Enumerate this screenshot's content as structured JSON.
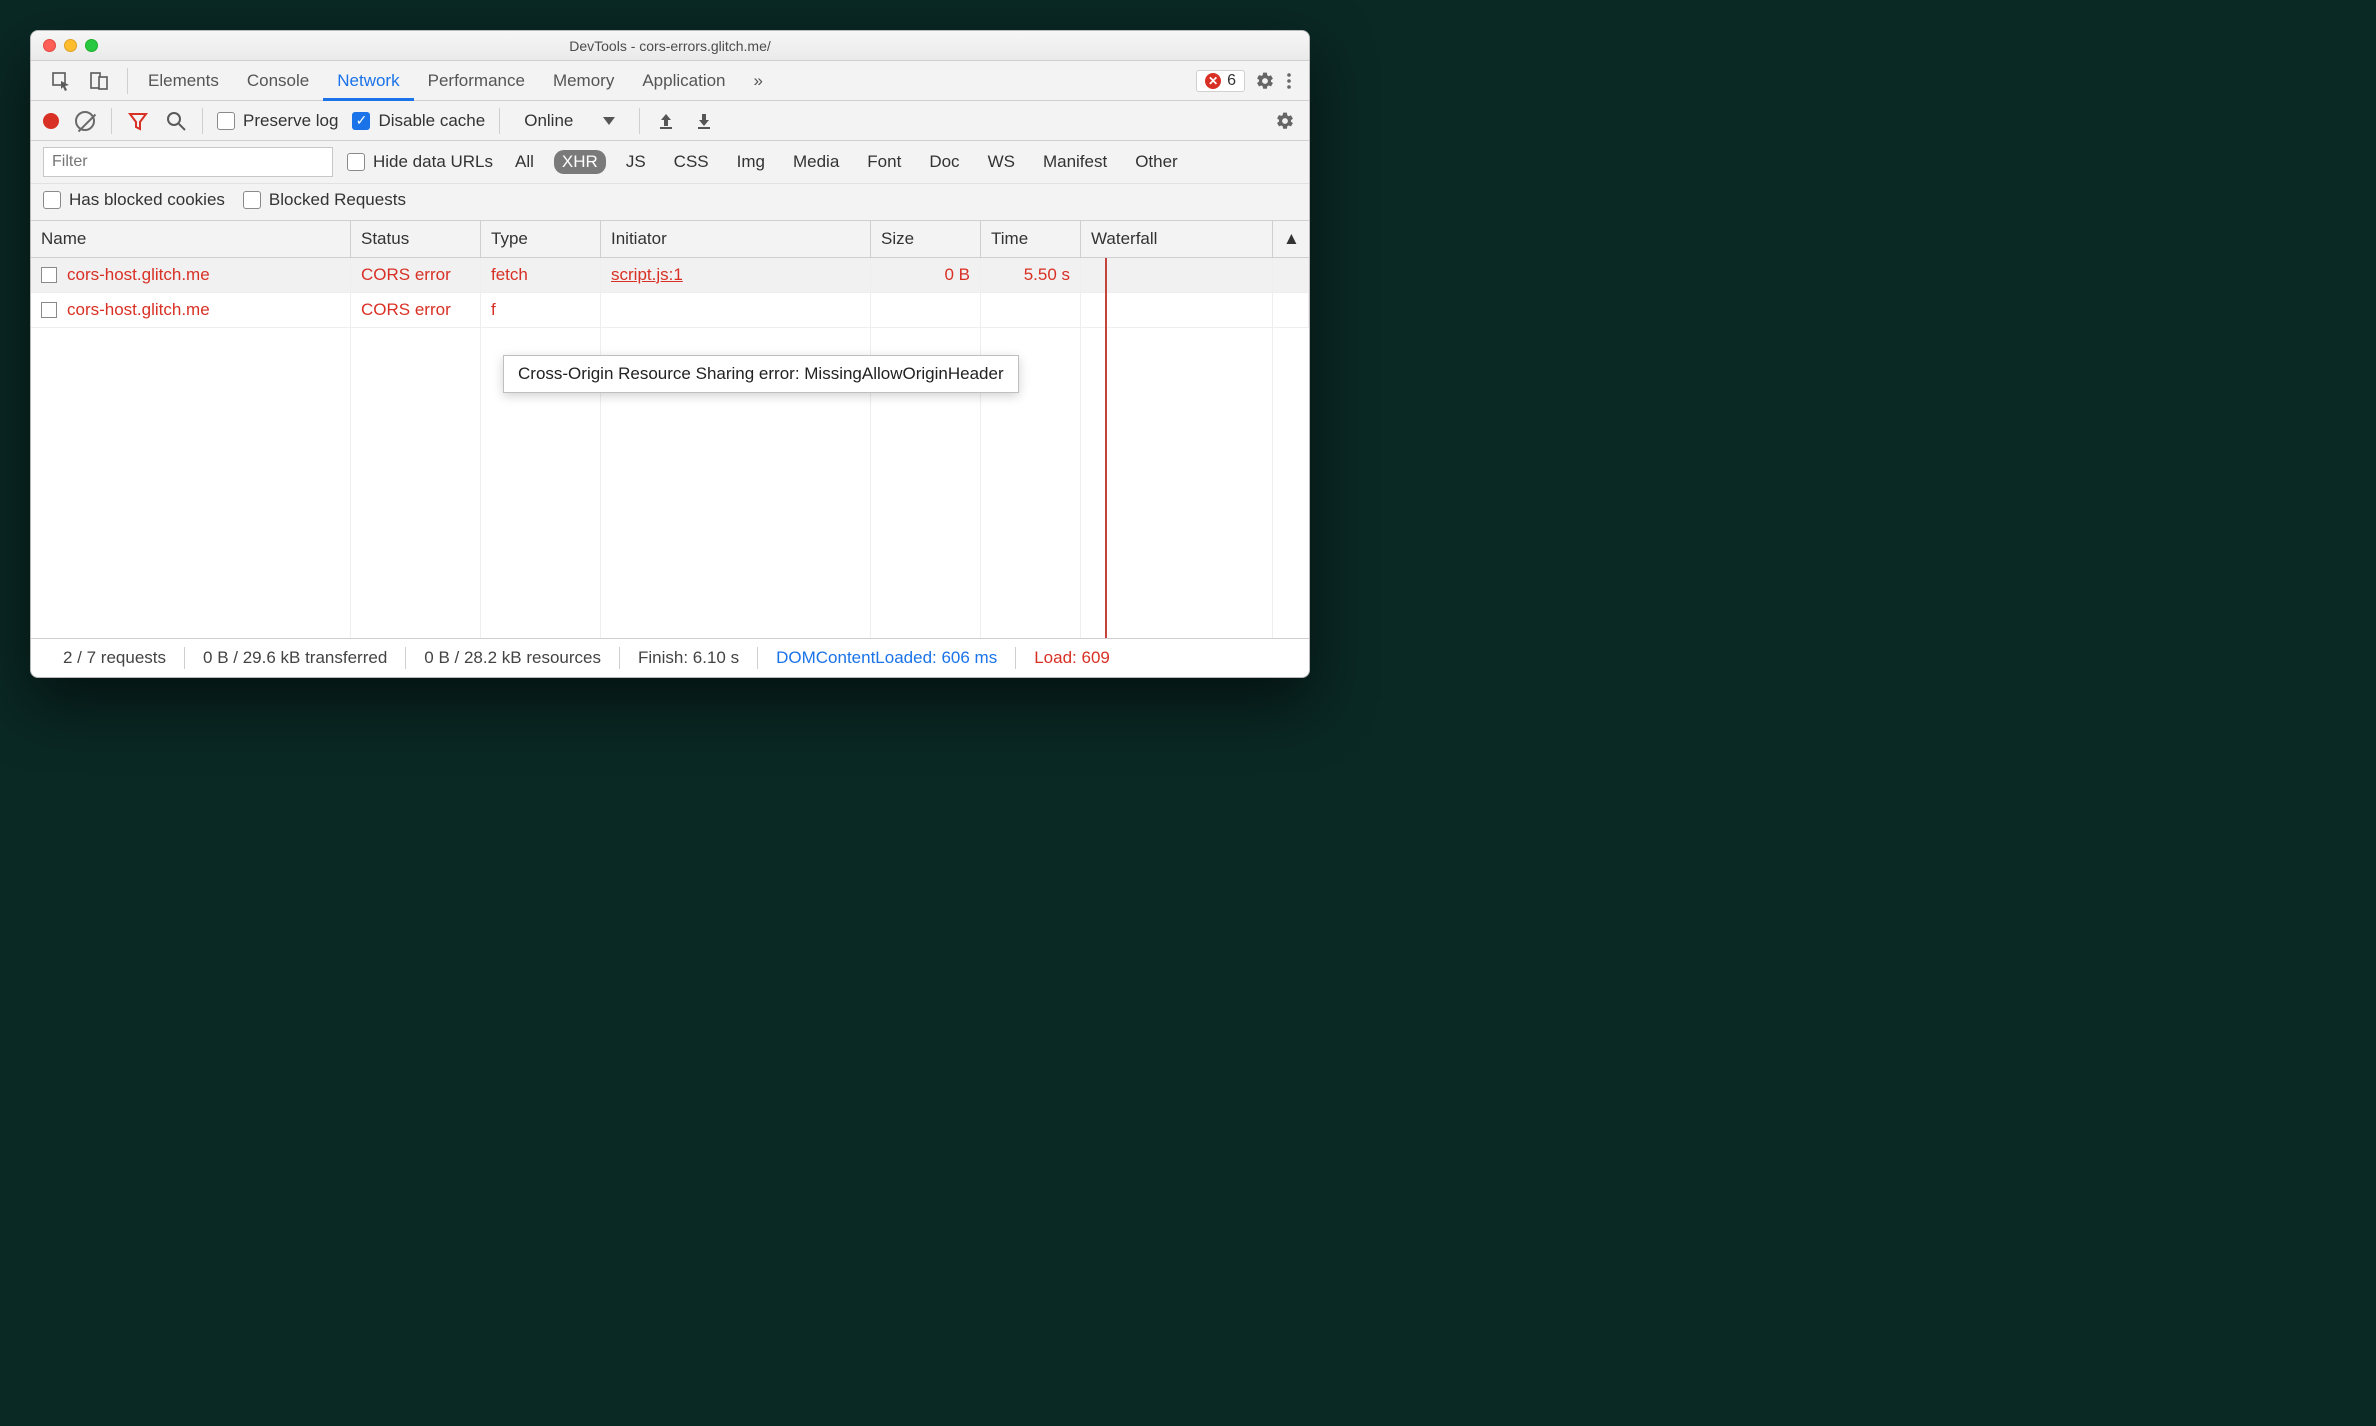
{
  "window": {
    "title": "DevTools - cors-errors.glitch.me/"
  },
  "tabs": {
    "items": [
      "Elements",
      "Console",
      "Network",
      "Performance",
      "Memory",
      "Application"
    ],
    "active": "Network",
    "overflow_icon": "»",
    "error_count": "6"
  },
  "nettoolbar": {
    "preserve_label": "Preserve log",
    "preserve_checked": false,
    "disable_label": "Disable cache",
    "disable_checked": true,
    "throttling_value": "Online"
  },
  "filterrow": {
    "filter_placeholder": "Filter",
    "hide_data_urls_label": "Hide data URLs",
    "hide_data_urls_checked": false,
    "types": [
      "All",
      "XHR",
      "JS",
      "CSS",
      "Img",
      "Media",
      "Font",
      "Doc",
      "WS",
      "Manifest",
      "Other"
    ],
    "active_type": "XHR"
  },
  "filterrow2": {
    "has_blocked_label": "Has blocked cookies",
    "has_blocked_checked": false,
    "blocked_req_label": "Blocked Requests",
    "blocked_req_checked": false
  },
  "columns": {
    "name": "Name",
    "status": "Status",
    "type": "Type",
    "initiator": "Initiator",
    "size": "Size",
    "time": "Time",
    "waterfall": "Waterfall",
    "sort_icon": "▲"
  },
  "rows": [
    {
      "name": "cors-host.glitch.me",
      "status": "CORS error",
      "type": "fetch",
      "initiator": "script.js:1",
      "size": "0 B",
      "time": "5.50 s",
      "hovered": true
    },
    {
      "name": "cors-host.glitch.me",
      "status": "CORS error",
      "type": "f",
      "initiator": "",
      "size": "",
      "time": "",
      "hovered": false
    }
  ],
  "tooltip": "Cross-Origin Resource Sharing error: MissingAllowOriginHeader",
  "statusbar": {
    "requests": "2 / 7 requests",
    "transferred": "0 B / 29.6 kB transferred",
    "resources": "0 B / 28.2 kB resources",
    "finish": "Finish: 6.10 s",
    "dcl": "DOMContentLoaded: 606 ms",
    "load": "Load: 609"
  }
}
